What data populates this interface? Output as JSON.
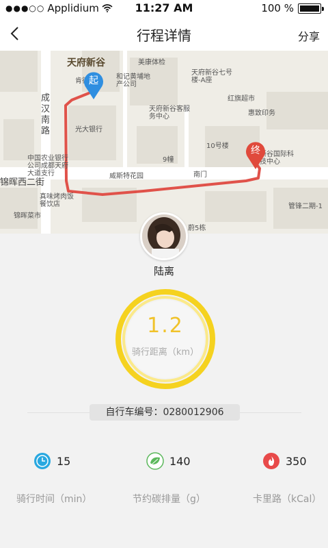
{
  "status_bar": {
    "signal": "●●●○○",
    "carrier": "Applidium",
    "time": "11:27 AM",
    "battery": "100 %"
  },
  "nav": {
    "title": "行程详情",
    "share_label": "分享"
  },
  "map": {
    "start_marker": "起",
    "end_marker": "终",
    "places": [
      "天府新谷",
      "美康体检",
      "天府新谷七号楼-A座",
      "肯德基",
      "和记黄埔地产公司",
      "红旗超市",
      "惠致印务",
      "成汉南路",
      "光大银行",
      "天府新谷客服务中心",
      "10号楼",
      "新谷国际科技中心",
      "中国农业银行公司成都天府大道支行",
      "9幢",
      "南门",
      "威斯特花园",
      "锦晖西二街",
      "真味烤肉饭餐饮店",
      "锦晖菜市",
      "管锋二期-1",
      "蔚5栋"
    ]
  },
  "user": {
    "name": "陆离"
  },
  "ride": {
    "distance": "1.2",
    "distance_label": "骑行距离（km）",
    "bike_id_text": "自行车编号：0280012906"
  },
  "stats": [
    {
      "value": "15",
      "label": "骑行时间（min）",
      "icon": "clock-icon",
      "color": "#29a8e0"
    },
    {
      "value": "140",
      "label": "节约碳排量（g）",
      "icon": "leaf-icon",
      "color": "#5cb85c"
    },
    {
      "value": "350",
      "label": "卡里路（kCal）",
      "icon": "flame-icon",
      "color": "#e84a4a"
    }
  ],
  "colors": {
    "route": "#e0524a",
    "gauge": "#f5d21f",
    "start_pin": "#2f8ee0",
    "end_pin": "#e04a3c"
  }
}
